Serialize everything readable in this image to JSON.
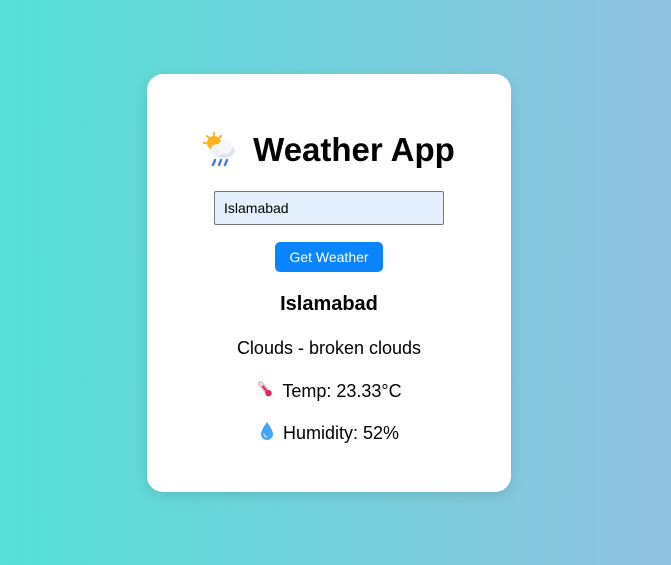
{
  "app": {
    "title": "Weather App",
    "title_icon": "sun-behind-rain-cloud-icon"
  },
  "search": {
    "value": "Islamabad",
    "button_label": "Get Weather"
  },
  "result": {
    "city": "Islamabad",
    "condition": "Clouds - broken clouds",
    "temp_text": "Temp: 23.33°C",
    "temp_icon": "thermometer-icon",
    "humidity_text": "Humidity: 52%",
    "humidity_icon": "droplet-icon"
  },
  "colors": {
    "background_left": "#55e0d7",
    "background_right": "#92c2e0",
    "button": "#0a84ff",
    "input_background": "#e3effc"
  }
}
